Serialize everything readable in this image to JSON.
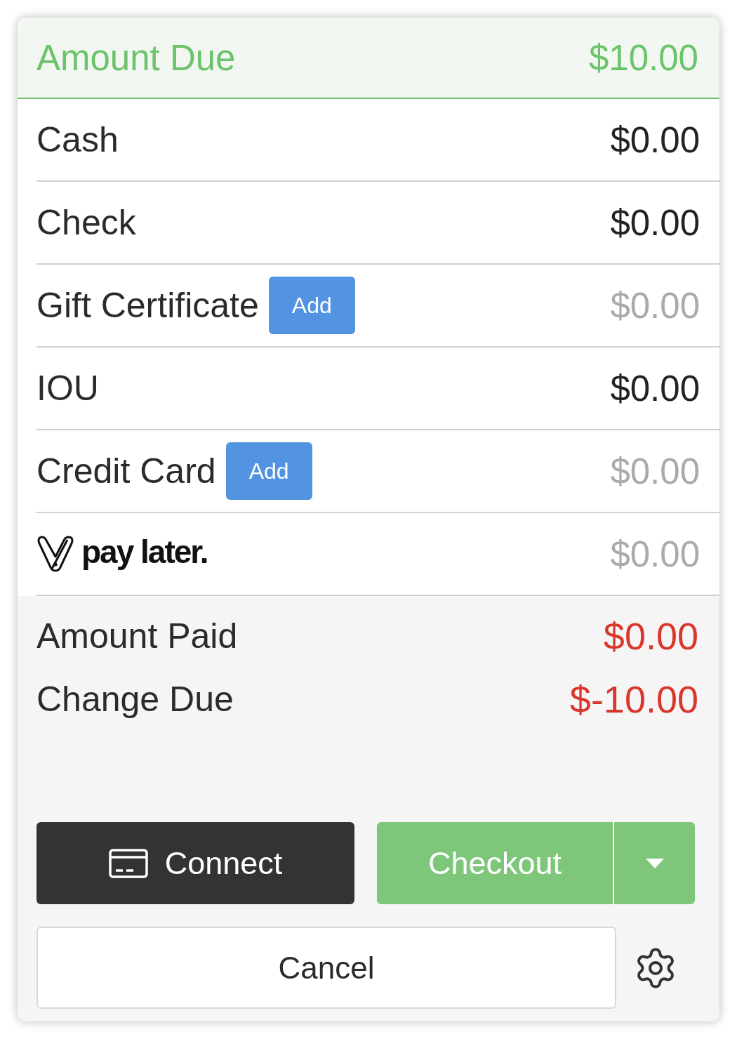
{
  "header": {
    "label": "Amount Due",
    "value": "$10.00"
  },
  "payment_methods": [
    {
      "kind": "text",
      "label": "Cash",
      "amount": "$0.00",
      "disabled": false
    },
    {
      "kind": "text",
      "label": "Check",
      "amount": "$0.00",
      "disabled": false
    },
    {
      "kind": "text",
      "label": "Gift Certificate",
      "button": "Add",
      "amount": "$0.00",
      "disabled": true
    },
    {
      "kind": "text",
      "label": "IOU",
      "amount": "$0.00",
      "disabled": false
    },
    {
      "kind": "text",
      "label": "Credit Card",
      "button": "Add",
      "amount": "$0.00",
      "disabled": true
    },
    {
      "kind": "logo",
      "label": "pay later.",
      "amount": "$0.00",
      "disabled": true
    }
  ],
  "summary": [
    {
      "label": "Amount Paid",
      "value": "$0.00",
      "alert": true
    },
    {
      "label": "Change Due",
      "value": "$-10.00",
      "alert": true
    }
  ],
  "actions": {
    "connect": "Connect",
    "checkout": "Checkout",
    "cancel": "Cancel"
  }
}
